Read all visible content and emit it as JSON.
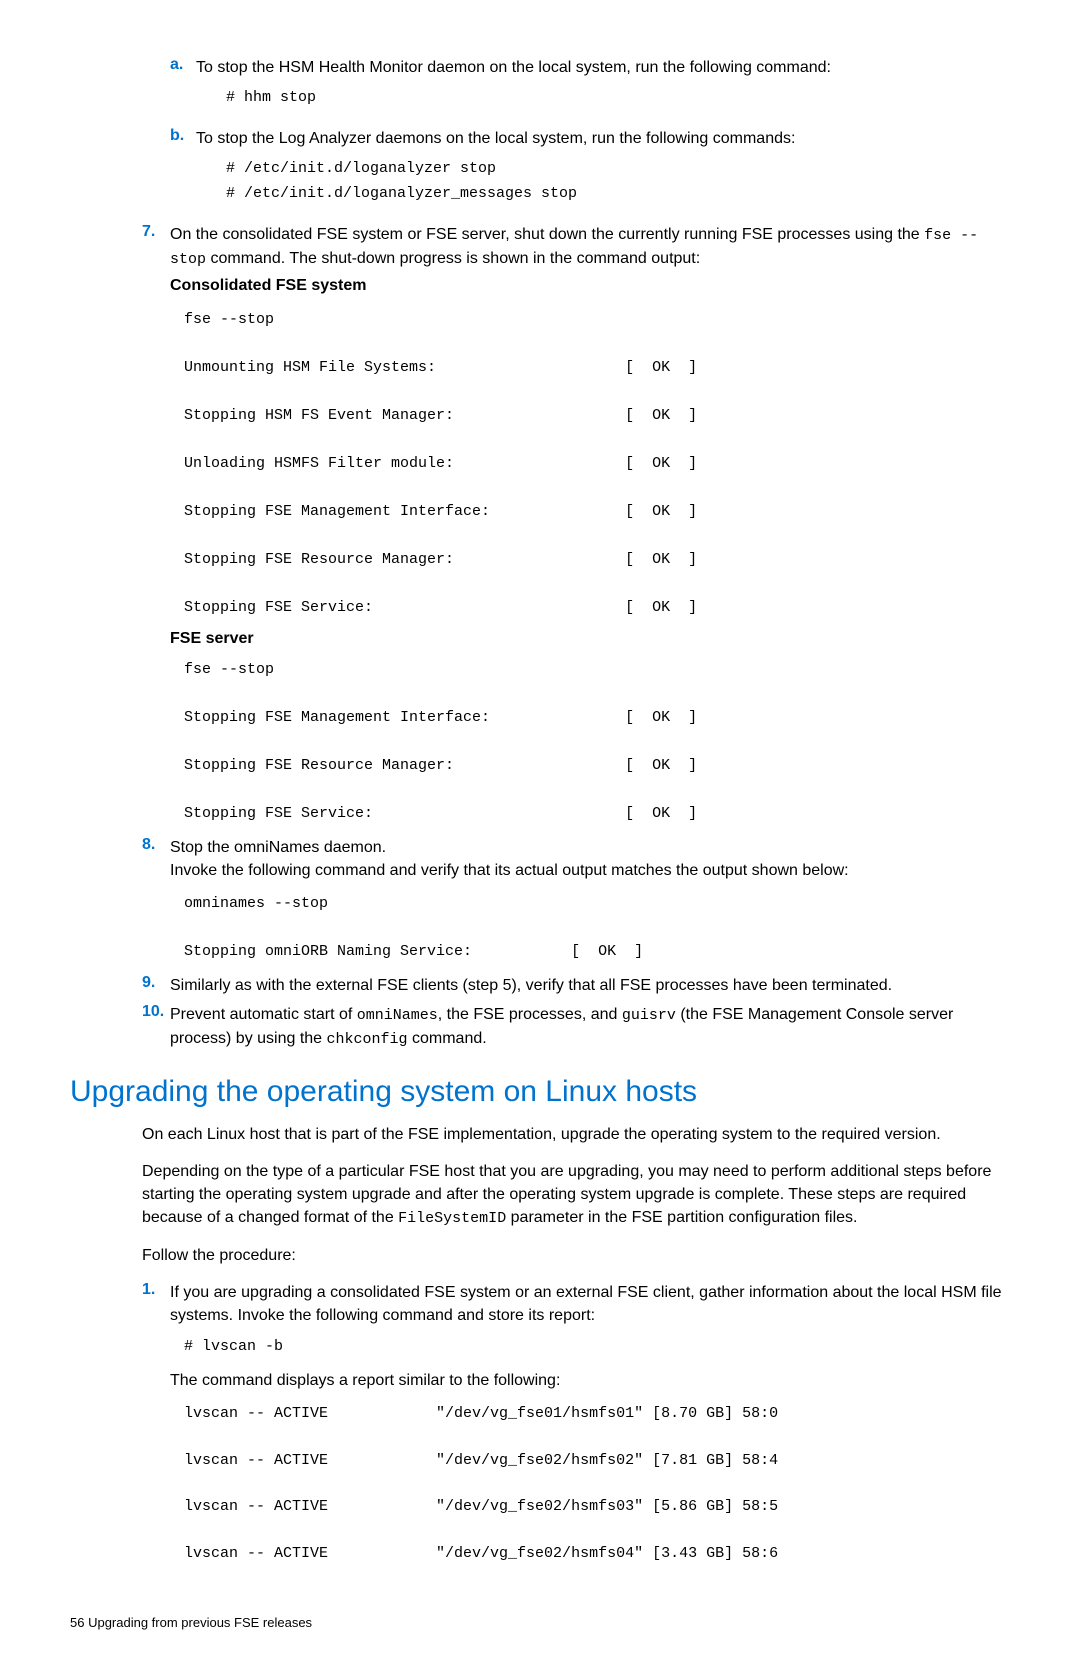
{
  "substeps": {
    "a": {
      "label": "a.",
      "text": "To stop the HSM Health Monitor daemon on the local system, run the following command:",
      "cmd": "# hhm stop"
    },
    "b": {
      "label": "b.",
      "text": "To stop the Log Analyzer daemons on the local system, run the following commands:",
      "cmd": "# /etc/init.d/loganalyzer stop\n# /etc/init.d/loganalyzer_messages stop"
    }
  },
  "step7": {
    "num": "7.",
    "text_a": "On the consolidated FSE system or FSE server, shut down the currently running FSE processes using the ",
    "code_inline": "fse --stop",
    "text_b": " command. The shut-down progress is shown in the command output:",
    "label1": "Consolidated FSE system",
    "out1": "fse --stop\n\nUnmounting HSM File Systems:                     [  OK  ]\n\nStopping HSM FS Event Manager:                   [  OK  ]\n\nUnloading HSMFS Filter module:                   [  OK  ]\n\nStopping FSE Management Interface:               [  OK  ]\n\nStopping FSE Resource Manager:                   [  OK  ]\n\nStopping FSE Service:                            [  OK  ]",
    "label2": "FSE server",
    "out2": "fse --stop\n\nStopping FSE Management Interface:               [  OK  ]\n\nStopping FSE Resource Manager:                   [  OK  ]\n\nStopping FSE Service:                            [  OK  ]"
  },
  "step8": {
    "num": "8.",
    "text1": "Stop the omniNames daemon.",
    "text2": "Invoke the following command and verify that its actual output matches the output shown below:",
    "out": "omninames --stop\n\nStopping omniORB Naming Service:           [  OK  ]"
  },
  "step9": {
    "num": "9.",
    "text": "Similarly as with the external FSE clients (step 5), verify that all FSE processes have been terminated."
  },
  "step10": {
    "num": "10.",
    "t1": "Prevent automatic start of ",
    "c1": "omniNames",
    "t2": ", the FSE processes, and ",
    "c2": "guisrv",
    "t3": " (the FSE Management Console server process) by using the ",
    "c3": "chkconfig",
    "t4": " command."
  },
  "h1": "Upgrading the operating system on Linux hosts",
  "p1": "On each Linux host that is part of the FSE implementation, upgrade the operating system to the required version.",
  "p2_a": "Depending on the type of a particular FSE host that you are upgrading, you may need to perform additional steps before starting the operating system upgrade and after the operating system upgrade is complete. These steps are required because of a changed format of the ",
  "p2_code": "FileSystemID",
  "p2_b": " parameter in the FSE partition configuration files.",
  "p3": "Follow the procedure:",
  "step1b": {
    "num": "1.",
    "text": "If you are upgrading a consolidated FSE system or an external FSE client, gather information about the local HSM file systems. Invoke the following command and store its report:",
    "cmd": "# lvscan -b",
    "text2": "The command displays a report similar to the following:",
    "out": "lvscan -- ACTIVE            \"/dev/vg_fse01/hsmfs01\" [8.70 GB] 58:0\n\nlvscan -- ACTIVE            \"/dev/vg_fse02/hsmfs02\" [7.81 GB] 58:4\n\nlvscan -- ACTIVE            \"/dev/vg_fse02/hsmfs03\" [5.86 GB] 58:5\n\nlvscan -- ACTIVE            \"/dev/vg_fse02/hsmfs04\" [3.43 GB] 58:6"
  },
  "footer": "56     Upgrading from previous FSE releases"
}
